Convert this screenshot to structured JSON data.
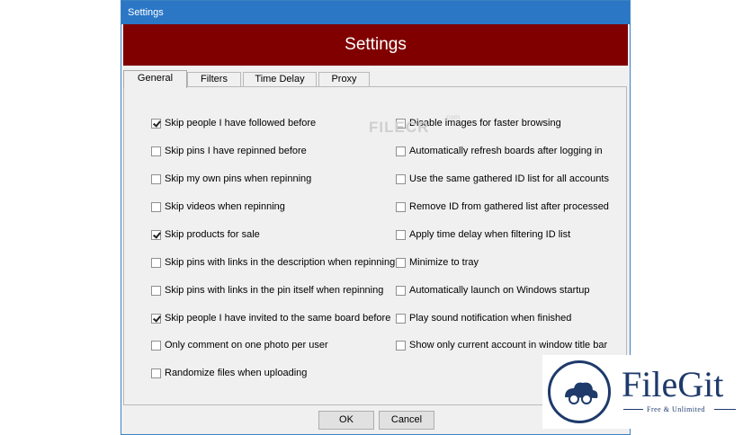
{
  "window": {
    "title": "Settings"
  },
  "header": {
    "title": "Settings"
  },
  "tabs": [
    {
      "label": "General",
      "active": true
    },
    {
      "label": "Filters",
      "active": false
    },
    {
      "label": "Time Delay",
      "active": false
    },
    {
      "label": "Proxy",
      "active": false
    }
  ],
  "left_options": [
    {
      "label": "Skip people I have followed before",
      "checked": true
    },
    {
      "label": "Skip pins I have repinned before",
      "checked": false
    },
    {
      "label": "Skip my own pins when repinning",
      "checked": false
    },
    {
      "label": "Skip videos when repinning",
      "checked": false
    },
    {
      "label": "Skip products for sale",
      "checked": true
    },
    {
      "label": "Skip pins with links in the description when repinning",
      "checked": false
    },
    {
      "label": "Skip pins with links in the pin itself when repinning",
      "checked": false
    },
    {
      "label": "Skip people I have invited to the same board before",
      "checked": true
    },
    {
      "label": "Only comment on one photo per user",
      "checked": false
    },
    {
      "label": "Randomize files when uploading",
      "checked": false
    }
  ],
  "right_options": [
    {
      "label": "Disable images for faster browsing",
      "checked": false
    },
    {
      "label": "Automatically refresh boards after logging in",
      "checked": false
    },
    {
      "label": "Use the same gathered ID list for all accounts",
      "checked": false
    },
    {
      "label": "Remove ID from gathered list after processed",
      "checked": false
    },
    {
      "label": "Apply time delay when filtering ID list",
      "checked": false
    },
    {
      "label": "Minimize to tray",
      "checked": false
    },
    {
      "label": "Automatically launch on Windows startup",
      "checked": false
    },
    {
      "label": "Play sound notification when finished",
      "checked": false
    },
    {
      "label": "Show only current account in window title bar",
      "checked": false
    }
  ],
  "buttons": {
    "ok": "OK",
    "cancel": "Cancel"
  },
  "watermark_filecr": {
    "text": "FILECR",
    "suffix": ".com"
  },
  "watermark_filegit": {
    "title": "FileGit",
    "tagline": "Free & Unlimited"
  },
  "colors": {
    "titlebar": "#2b77c6",
    "banner": "#800000",
    "brand": "#1e3a6b"
  }
}
